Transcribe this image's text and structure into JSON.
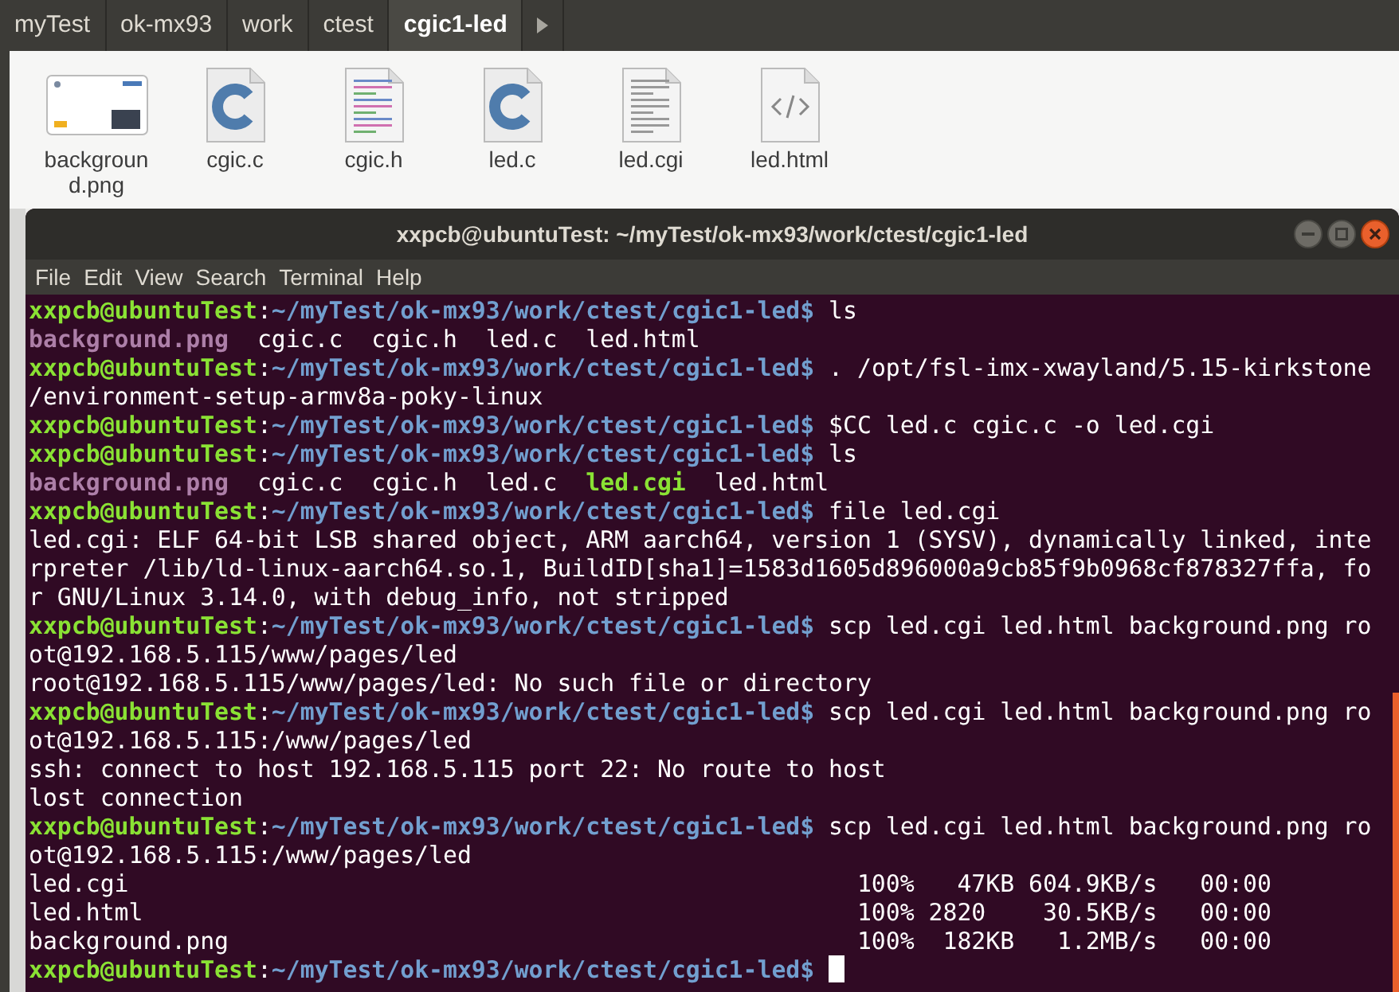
{
  "breadcrumbs": [
    {
      "label": "myTest",
      "selected": false
    },
    {
      "label": "ok-mx93",
      "selected": false
    },
    {
      "label": "work",
      "selected": false
    },
    {
      "label": "ctest",
      "selected": false
    },
    {
      "label": "cgic1-led",
      "selected": true
    }
  ],
  "files": [
    {
      "name": "backgroun\nd.png",
      "kind": "image"
    },
    {
      "name": "cgic.c",
      "kind": "c"
    },
    {
      "name": "cgic.h",
      "kind": "header"
    },
    {
      "name": "led.c",
      "kind": "c"
    },
    {
      "name": "led.cgi",
      "kind": "text"
    },
    {
      "name": "led.html",
      "kind": "html"
    }
  ],
  "terminal": {
    "title": "xxpcb@ubuntuTest: ~/myTest/ok-mx93/work/ctest/cgic1-led",
    "menu": [
      "File",
      "Edit",
      "View",
      "Search",
      "Terminal",
      "Help"
    ],
    "lines": [
      [
        {
          "kind": "user",
          "text": "xxpcb@ubuntuTest"
        },
        {
          "kind": "plain",
          "text": ":"
        },
        {
          "kind": "path",
          "text": "~/myTest/ok-mx93/work/ctest/cgic1-led$"
        },
        {
          "kind": "plain",
          "text": " ls"
        }
      ],
      [
        {
          "kind": "image",
          "text": "background.png"
        },
        {
          "kind": "plain",
          "text": "  cgic.c  cgic.h  led.c  led.html"
        }
      ],
      [
        {
          "kind": "user",
          "text": "xxpcb@ubuntuTest"
        },
        {
          "kind": "plain",
          "text": ":"
        },
        {
          "kind": "path",
          "text": "~/myTest/ok-mx93/work/ctest/cgic1-led$"
        },
        {
          "kind": "plain",
          "text": " . /opt/fsl-imx-xwayland/5.15-kirkstone"
        }
      ],
      [
        {
          "kind": "plain",
          "text": "/environment-setup-armv8a-poky-linux"
        }
      ],
      [
        {
          "kind": "user",
          "text": "xxpcb@ubuntuTest"
        },
        {
          "kind": "plain",
          "text": ":"
        },
        {
          "kind": "path",
          "text": "~/myTest/ok-mx93/work/ctest/cgic1-led$"
        },
        {
          "kind": "plain",
          "text": " $CC led.c cgic.c -o led.cgi"
        }
      ],
      [
        {
          "kind": "user",
          "text": "xxpcb@ubuntuTest"
        },
        {
          "kind": "plain",
          "text": ":"
        },
        {
          "kind": "path",
          "text": "~/myTest/ok-mx93/work/ctest/cgic1-led$"
        },
        {
          "kind": "plain",
          "text": " ls"
        }
      ],
      [
        {
          "kind": "image",
          "text": "background.png"
        },
        {
          "kind": "plain",
          "text": "  cgic.c  cgic.h  led.c  "
        },
        {
          "kind": "executable",
          "text": "led.cgi"
        },
        {
          "kind": "plain",
          "text": "  led.html"
        }
      ],
      [
        {
          "kind": "user",
          "text": "xxpcb@ubuntuTest"
        },
        {
          "kind": "plain",
          "text": ":"
        },
        {
          "kind": "path",
          "text": "~/myTest/ok-mx93/work/ctest/cgic1-led$"
        },
        {
          "kind": "plain",
          "text": " file led.cgi"
        }
      ],
      [
        {
          "kind": "plain",
          "text": "led.cgi: ELF 64-bit LSB shared object, ARM aarch64, version 1 (SYSV), dynamically linked, inte"
        }
      ],
      [
        {
          "kind": "plain",
          "text": "rpreter /lib/ld-linux-aarch64.so.1, BuildID[sha1]=1583d1605d896000a9cb85f9b0968cf878327ffa, fo"
        }
      ],
      [
        {
          "kind": "plain",
          "text": "r GNU/Linux 3.14.0, with debug_info, not stripped"
        }
      ],
      [
        {
          "kind": "user",
          "text": "xxpcb@ubuntuTest"
        },
        {
          "kind": "plain",
          "text": ":"
        },
        {
          "kind": "path",
          "text": "~/myTest/ok-mx93/work/ctest/cgic1-led$"
        },
        {
          "kind": "plain",
          "text": " scp led.cgi led.html background.png ro"
        }
      ],
      [
        {
          "kind": "plain",
          "text": "ot@192.168.5.115/www/pages/led"
        }
      ],
      [
        {
          "kind": "plain",
          "text": "root@192.168.5.115/www/pages/led: No such file or directory"
        }
      ],
      [
        {
          "kind": "user",
          "text": "xxpcb@ubuntuTest"
        },
        {
          "kind": "plain",
          "text": ":"
        },
        {
          "kind": "path",
          "text": "~/myTest/ok-mx93/work/ctest/cgic1-led$"
        },
        {
          "kind": "plain",
          "text": " scp led.cgi led.html background.png ro"
        }
      ],
      [
        {
          "kind": "plain",
          "text": "ot@192.168.5.115:/www/pages/led"
        }
      ],
      [
        {
          "kind": "plain",
          "text": "ssh: connect to host 192.168.5.115 port 22: No route to host"
        }
      ],
      [
        {
          "kind": "plain",
          "text": "lost connection"
        }
      ],
      [
        {
          "kind": "user",
          "text": "xxpcb@ubuntuTest"
        },
        {
          "kind": "plain",
          "text": ":"
        },
        {
          "kind": "path",
          "text": "~/myTest/ok-mx93/work/ctest/cgic1-led$"
        },
        {
          "kind": "plain",
          "text": " scp led.cgi led.html background.png ro"
        }
      ],
      [
        {
          "kind": "plain",
          "text": "ot@192.168.5.115:/www/pages/led"
        }
      ],
      [
        {
          "kind": "file",
          "text": "led.cgi"
        },
        {
          "kind": "plain",
          "text": "100%   47KB 604.9KB/s   00:00"
        }
      ],
      [
        {
          "kind": "file",
          "text": "led.html"
        },
        {
          "kind": "plain",
          "text": "100% 2820    30.5KB/s   00:00"
        }
      ],
      [
        {
          "kind": "file",
          "text": "background.png"
        },
        {
          "kind": "plain",
          "text": "100%  182KB   1.2MB/s   00:00"
        }
      ],
      [
        {
          "kind": "user",
          "text": "xxpcb@ubuntuTest"
        },
        {
          "kind": "plain",
          "text": ":"
        },
        {
          "kind": "path",
          "text": "~/myTest/ok-mx93/work/ctest/cgic1-led$"
        },
        {
          "kind": "cursor"
        }
      ]
    ]
  }
}
